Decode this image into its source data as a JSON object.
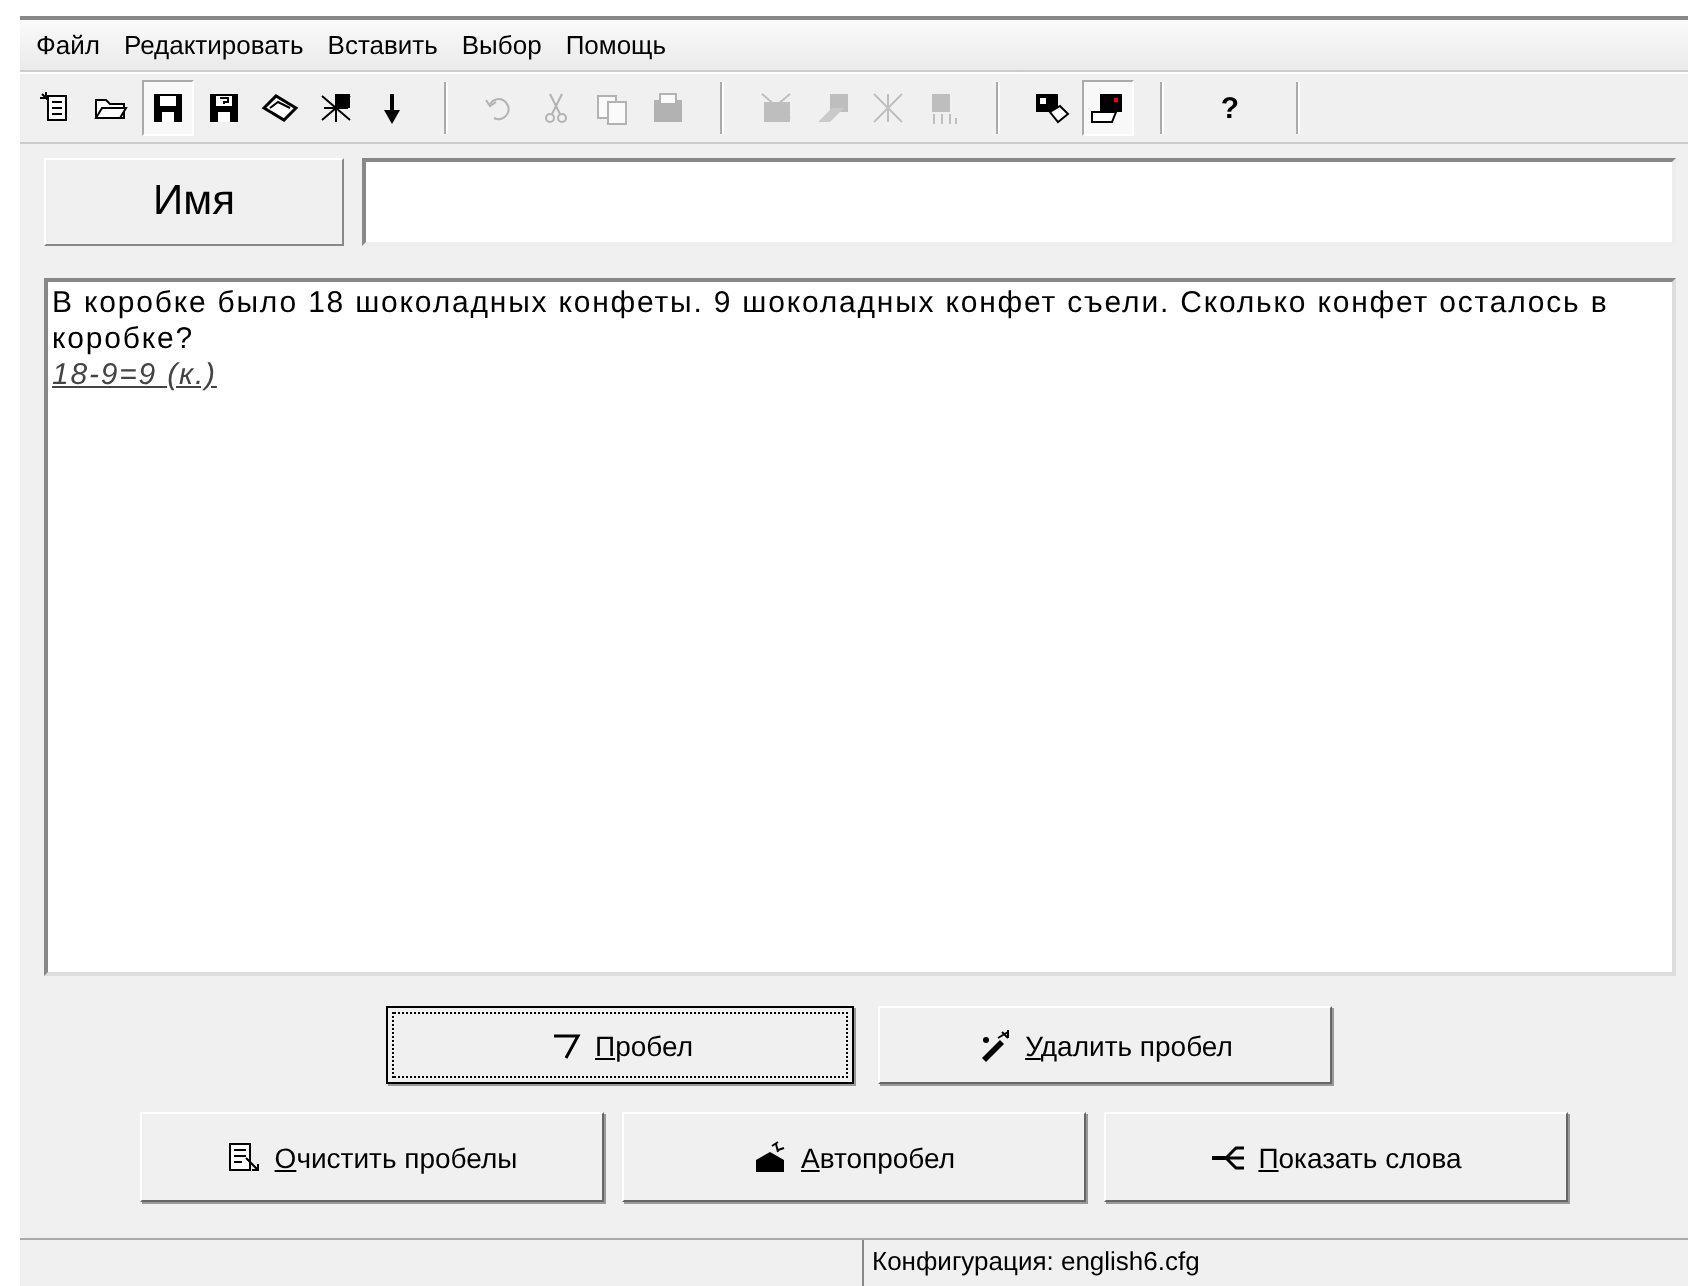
{
  "menu": [
    "Файл",
    "Редактировать",
    "Вставить",
    "Выбор",
    "Помощь"
  ],
  "toolbar": [
    {
      "kind": "button",
      "disabled": false,
      "pressed": false
    },
    {
      "kind": "button",
      "disabled": false,
      "pressed": false
    },
    {
      "kind": "button",
      "disabled": false,
      "pressed": true
    },
    {
      "kind": "button",
      "disabled": false,
      "pressed": false
    },
    {
      "kind": "button",
      "disabled": false,
      "pressed": false
    },
    {
      "kind": "button",
      "disabled": false,
      "pressed": false
    },
    {
      "kind": "button",
      "disabled": false,
      "pressed": false
    },
    {
      "kind": "separator"
    },
    {
      "kind": "button",
      "disabled": true,
      "pressed": false
    },
    {
      "kind": "button",
      "disabled": true,
      "pressed": false
    },
    {
      "kind": "button",
      "disabled": true,
      "pressed": false
    },
    {
      "kind": "button",
      "disabled": true,
      "pressed": false
    },
    {
      "kind": "separator"
    },
    {
      "kind": "button",
      "disabled": true,
      "pressed": false
    },
    {
      "kind": "button",
      "disabled": true,
      "pressed": false
    },
    {
      "kind": "button",
      "disabled": true,
      "pressed": false
    },
    {
      "kind": "button",
      "disabled": true,
      "pressed": false
    },
    {
      "kind": "separator"
    },
    {
      "kind": "button",
      "disabled": false,
      "pressed": false
    },
    {
      "kind": "button",
      "disabled": false,
      "pressed": true
    },
    {
      "kind": "separator"
    },
    {
      "kind": "help",
      "label": "?",
      "disabled": false,
      "pressed": false
    },
    {
      "kind": "separator"
    }
  ],
  "name_label": "Имя",
  "document": {
    "problem": "В коробке было 18 шоколадных конфеты. 9 шоколадных конфет съели. Сколько конфет осталось в коробке?",
    "answer": "18-9=9 (к.)"
  },
  "button_rows": [
    [
      {
        "key": "П",
        "rest": "робел",
        "focused": true
      },
      {
        "key": "У",
        "rest": "далить пробел",
        "focused": false
      }
    ],
    [
      {
        "key": "О",
        "rest": "чистить пробелы",
        "focused": false
      },
      {
        "key": "А",
        "rest": "втопробел",
        "focused": false
      },
      {
        "key": "П",
        "rest": "оказать слова",
        "focused": false
      }
    ]
  ],
  "status_bar": {
    "config": "Конфигурация: english6.cfg"
  }
}
